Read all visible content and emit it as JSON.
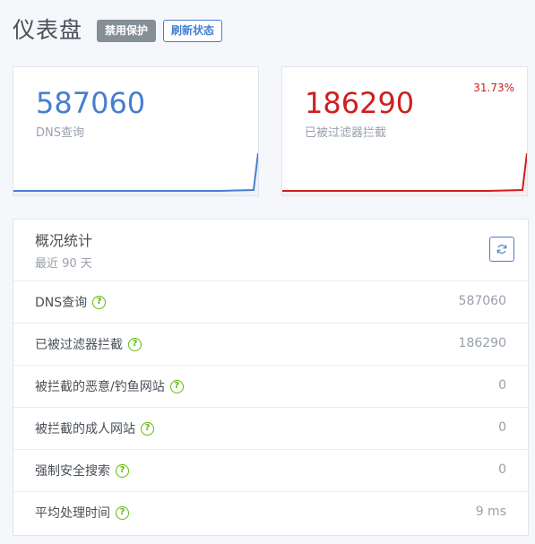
{
  "header": {
    "title": "仪表盘",
    "disable_protection_label": "禁用保护",
    "refresh_status_label": "刷新状态"
  },
  "colors": {
    "blue": "#467fcf",
    "red": "#cd201f",
    "green": "#5eba00",
    "gray_button": "#868e96"
  },
  "cards": {
    "dns": {
      "value": "587060",
      "label": "DNS查询"
    },
    "blocked": {
      "value": "186290",
      "label": "已被过滤器拦截",
      "percent": "31.73%"
    }
  },
  "stats": {
    "title": "概况统计",
    "subtitle": "最近 90 天",
    "refresh_icon": "refresh-icon",
    "help_icon": "question-circle-icon",
    "rows": [
      {
        "label": "DNS查询",
        "value": "587060"
      },
      {
        "label": "已被过滤器拦截",
        "value": "186290"
      },
      {
        "label": "被拦截的恶意/钓鱼网站",
        "value": "0"
      },
      {
        "label": "被拦截的成人网站",
        "value": "0"
      },
      {
        "label": "强制安全搜索",
        "value": "0"
      },
      {
        "label": "平均处理时间",
        "value": "9 ms"
      }
    ]
  }
}
